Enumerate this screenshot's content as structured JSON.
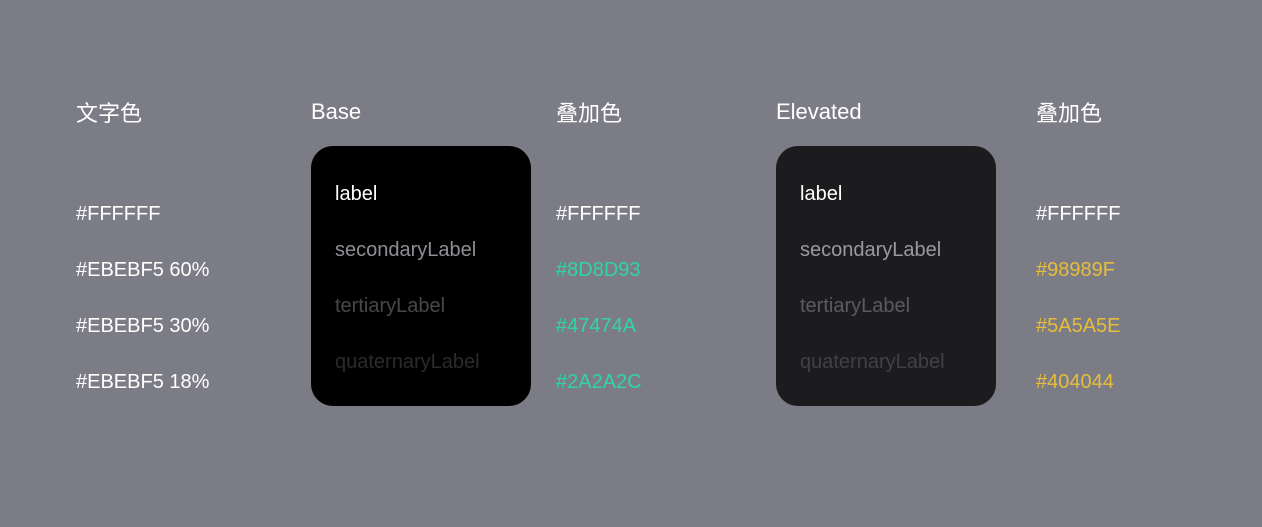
{
  "headers": {
    "text_color": "文字色",
    "base": "Base",
    "overlay_base": "叠加色",
    "elevated": "Elevated",
    "overlay_elevated": "叠加色"
  },
  "rows": {
    "definitions": [
      {
        "value": "#FFFFFF",
        "def_color": "#FFFFFF"
      },
      {
        "value": "#EBEBF5 60%",
        "def_color": "#FFFFFF"
      },
      {
        "value": "#EBEBF5 30%",
        "def_color": "#FFFFFF"
      },
      {
        "value": "#EBEBF5 18%",
        "def_color": "#FFFFFF"
      }
    ],
    "labels": [
      {
        "text": "label",
        "base_color": "#FFFFFF",
        "elevated_color": "#FFFFFF"
      },
      {
        "text": "secondaryLabel",
        "base_color": "rgba(235,235,245,0.60)",
        "elevated_color": "rgba(235,235,245,0.60)"
      },
      {
        "text": "tertiaryLabel",
        "base_color": "rgba(235,235,245,0.30)",
        "elevated_color": "rgba(235,235,245,0.30)"
      },
      {
        "text": "quaternaryLabel",
        "base_color": "rgba(235,235,245,0.18)",
        "elevated_color": "rgba(235,235,245,0.18)"
      }
    ],
    "overlay_base": [
      {
        "value": "#FFFFFF",
        "color": "#FFFFFF"
      },
      {
        "value": "#8D8D93",
        "color": "#30D5A4"
      },
      {
        "value": "#47474A",
        "color": "#30D5A4"
      },
      {
        "value": "#2A2A2C",
        "color": "#30D5A4"
      }
    ],
    "overlay_elevated": [
      {
        "value": "#FFFFFF",
        "color": "#FFFFFF"
      },
      {
        "value": "#98989F",
        "color": "#E6BE3A"
      },
      {
        "value": "#5A5A5E",
        "color": "#E6BE3A"
      },
      {
        "value": "#404044",
        "color": "#E6BE3A"
      }
    ]
  }
}
